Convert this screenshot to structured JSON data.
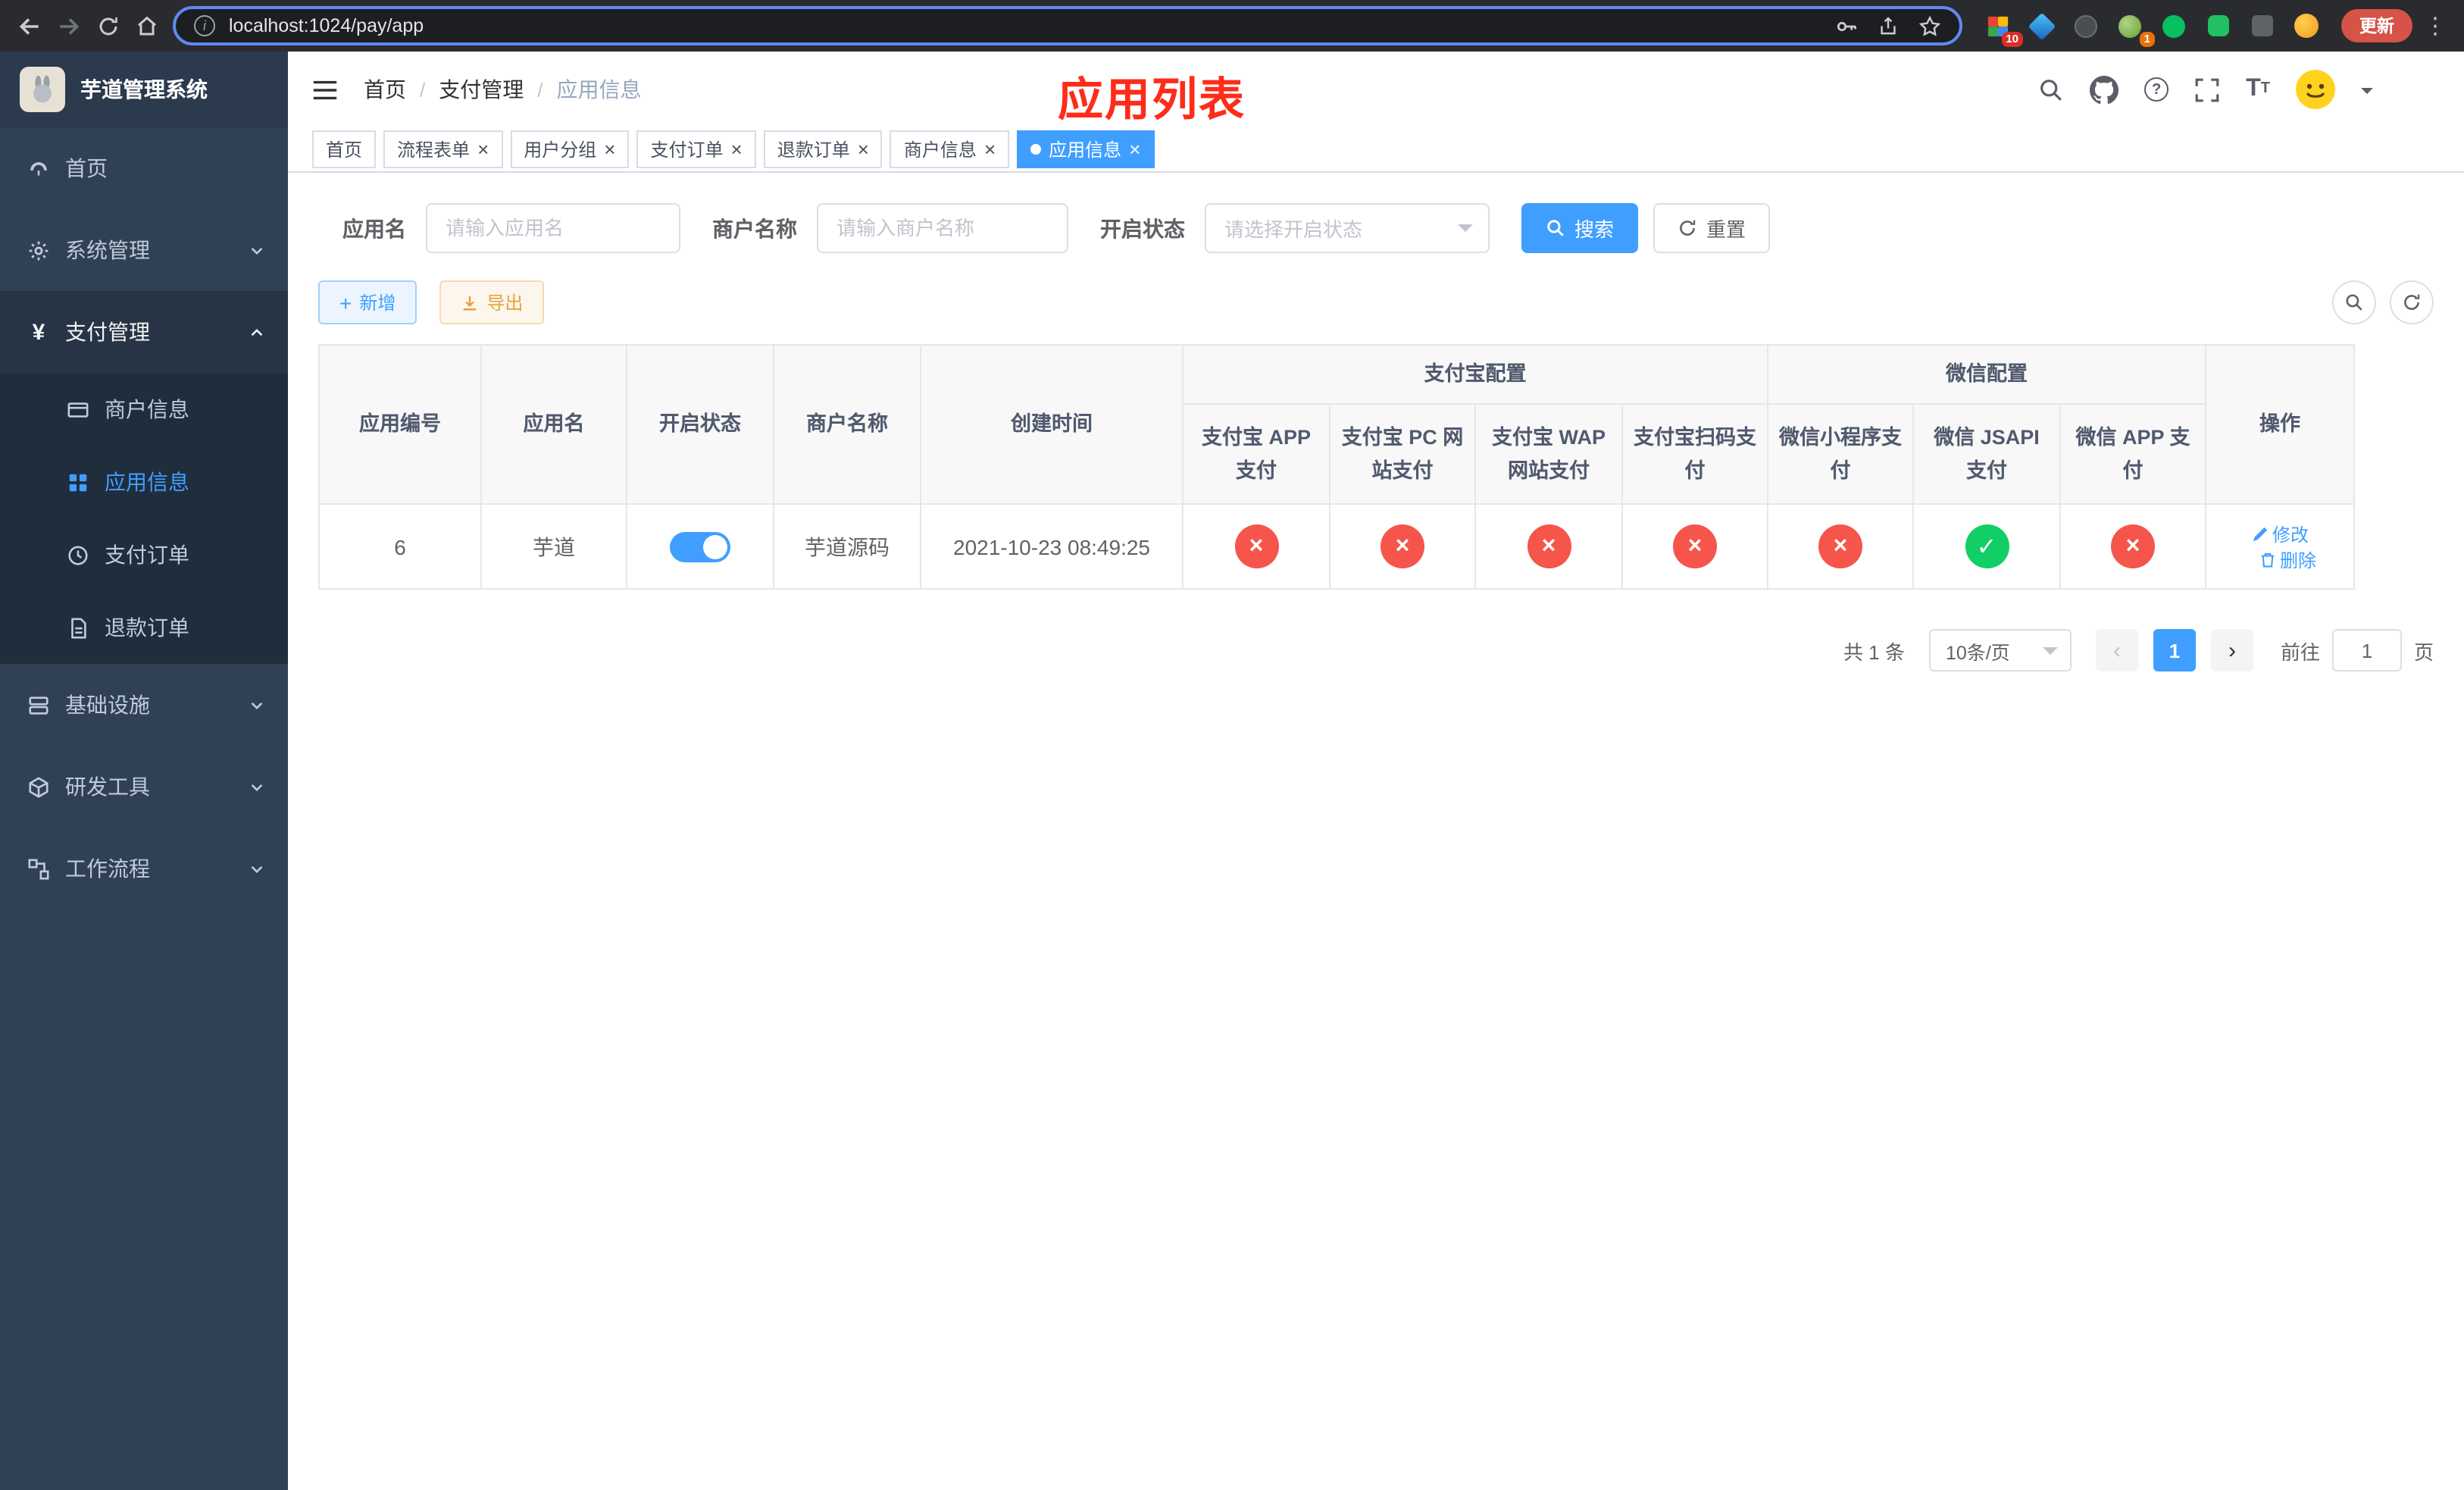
{
  "theme": {
    "accent": "#409EFF",
    "success": "#12CE66",
    "danger": "#F5554B",
    "warning": "#E6A23C",
    "sidebar_bg": "#304156",
    "submenu_bg": "#1F2D3D",
    "annotation_red": "#FE2C19"
  },
  "browser": {
    "url": "localhost:1024/pay/app",
    "update_label": "更新",
    "extension_badge_puzzle": "10",
    "extension_badge_toolbox": "1"
  },
  "sidebar": {
    "title": "芋道管理系统",
    "items": [
      {
        "label": "首页"
      },
      {
        "label": "系统管理"
      },
      {
        "label": "支付管理"
      },
      {
        "label": "基础设施"
      },
      {
        "label": "研发工具"
      },
      {
        "label": "工作流程"
      }
    ],
    "pay_submenu": [
      {
        "label": "商户信息"
      },
      {
        "label": "应用信息",
        "active": true
      },
      {
        "label": "支付订单"
      },
      {
        "label": "退款订单"
      }
    ]
  },
  "header": {
    "breadcrumb": [
      "首页",
      "支付管理",
      "应用信息"
    ],
    "annotation": "应用列表"
  },
  "tabs": [
    {
      "label": "首页",
      "closable": false,
      "active": false
    },
    {
      "label": "流程表单",
      "closable": true,
      "active": false
    },
    {
      "label": "用户分组",
      "closable": true,
      "active": false
    },
    {
      "label": "支付订单",
      "closable": true,
      "active": false
    },
    {
      "label": "退款订单",
      "closable": true,
      "active": false
    },
    {
      "label": "商户信息",
      "closable": true,
      "active": false
    },
    {
      "label": "应用信息",
      "closable": true,
      "active": true
    }
  ],
  "filters": {
    "app_name_label": "应用名",
    "app_name_placeholder": "请输入应用名",
    "merchant_label": "商户名称",
    "merchant_placeholder": "请输入商户名称",
    "status_label": "开启状态",
    "status_placeholder": "请选择开启状态",
    "search_label": "搜索",
    "reset_label": "重置"
  },
  "toolbar": {
    "add_label": "新增",
    "export_label": "导出"
  },
  "table": {
    "group_headers": {
      "alipay": "支付宝配置",
      "wechat": "微信配置"
    },
    "columns": [
      "应用编号",
      "应用名",
      "开启状态",
      "商户名称",
      "创建时间",
      "支付宝 APP 支付",
      "支付宝 PC 网站支付",
      "支付宝 WAP 网站支付",
      "支付宝扫码支付",
      "微信小程序支付",
      "微信 JSAPI 支付",
      "微信 APP 支付",
      "操作"
    ],
    "row": {
      "id": "6",
      "name": "芋道",
      "status_on": true,
      "merchant": "芋道源码",
      "created": "2021-10-23 08:49:25",
      "channels": [
        false,
        false,
        false,
        false,
        false,
        true,
        false
      ],
      "edit_label": "修改",
      "delete_label": "删除"
    }
  },
  "pagination": {
    "total_label": "共 1 条",
    "page_size": "10条/页",
    "current_page": "1",
    "goto_label": "前往",
    "goto_value": "1",
    "page_suffix": "页"
  }
}
